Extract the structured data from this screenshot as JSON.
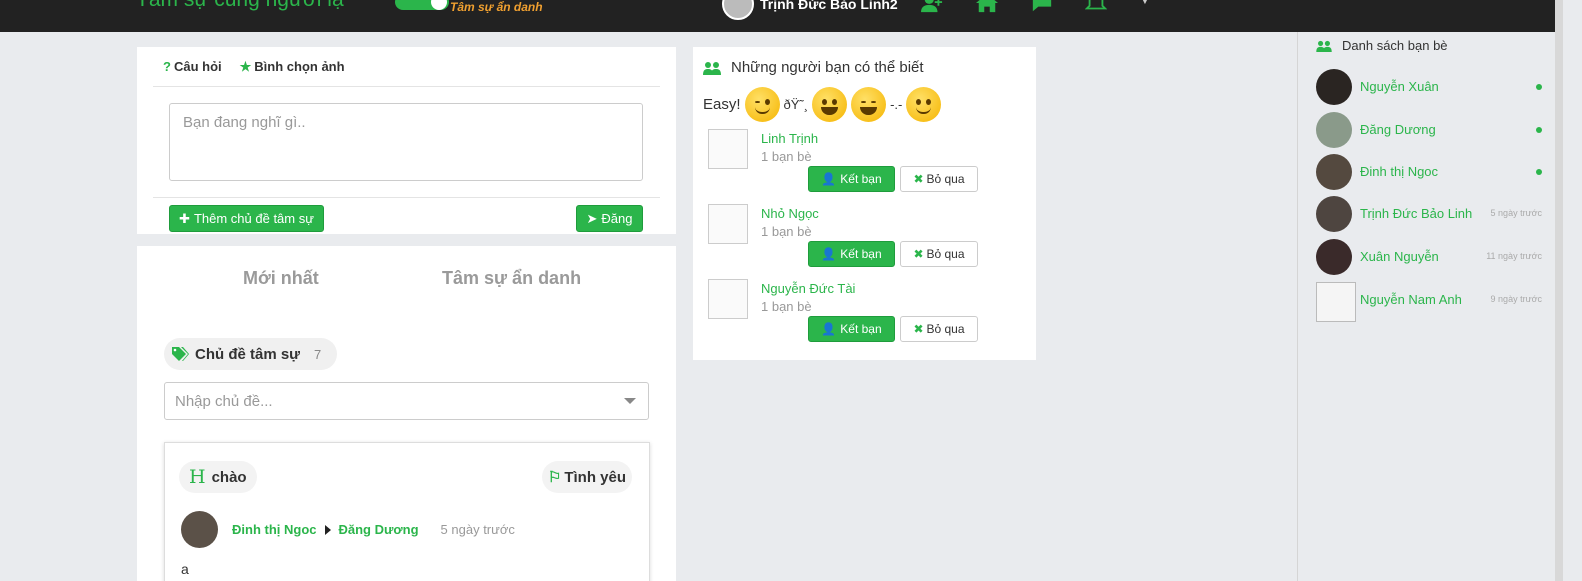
{
  "header": {
    "brand": "Tâm sự cùng người lạ",
    "anon_label": "Tâm sự ẩn danh",
    "user_name": "Trịnh Đức Bảo Linh2"
  },
  "composer": {
    "tab_question": "Câu hỏi",
    "tab_vote": "Bình chọn ảnh",
    "placeholder": "Bạn đang nghĩ gì..",
    "add_topic_label": "Thêm chủ đề tâm sự",
    "post_label": "Đăng"
  },
  "feed": {
    "tab_latest": "Mới nhất",
    "tab_anon": "Tâm sự ẩn danh",
    "topic_label": "Chủ đề tâm sự",
    "topic_count": "7",
    "topic_placeholder": "Nhập chủ đề...",
    "post": {
      "title_initial": "H",
      "title": "chào",
      "tag": "Tình yêu",
      "author": "Đinh thị Ngoc",
      "target": "Đăng Dương",
      "time": "5 ngày trước",
      "body": "a"
    }
  },
  "suggest": {
    "heading": "Những người bạn có thể biết",
    "emoji_prefix": "Easy!",
    "emoji_garbled": "ðŸ˜¸",
    "emoji_sep": "-.-",
    "add_label": "Kết bạn",
    "skip_label": "Bỏ qua",
    "people": [
      {
        "name": "Linh Trịnh",
        "count": "1 bạn bè"
      },
      {
        "name": "Nhỏ Ngọc",
        "count": "1 bạn bè"
      },
      {
        "name": "Nguyễn Đức Tài",
        "count": "1 bạn bè"
      }
    ]
  },
  "sidebar": {
    "heading": "Danh sách bạn bè",
    "friends": [
      {
        "name": "Nguyễn Xuân",
        "status": "online"
      },
      {
        "name": "Đăng Dương",
        "status": "online"
      },
      {
        "name": "Đinh thị Ngoc",
        "status": "online"
      },
      {
        "name": "Trịnh Đức Bảo Linh",
        "time": "5 ngày trước"
      },
      {
        "name": "Xuân Nguyễn",
        "time": "11 ngày trước"
      },
      {
        "name": "Nguyễn Nam Anh",
        "time": "9 ngày trước"
      }
    ]
  },
  "colors": {
    "accent": "#2bb54b",
    "topbar": "#222222",
    "background": "#e9ebee"
  }
}
